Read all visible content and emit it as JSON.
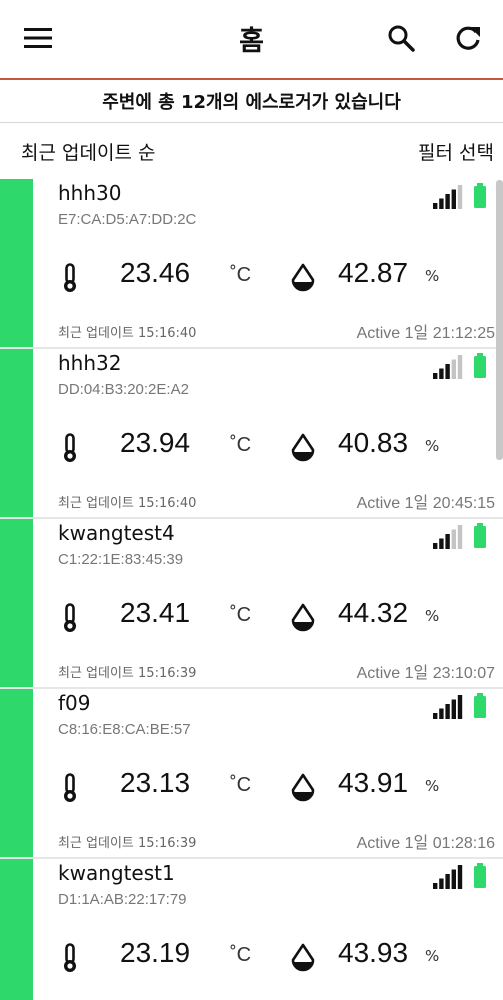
{
  "appbar": {
    "title": "홈",
    "menu_icon": "menu-icon",
    "search_icon": "search-icon",
    "refresh_icon": "refresh-icon",
    "divider_color": "#c8553d"
  },
  "banner": {
    "text": "주변에 총 12개의 에스로거가 있습니다"
  },
  "sortbar": {
    "sort_label": "최근 업데이트 순",
    "filter_label": "필터 선택"
  },
  "colors": {
    "active_strip": "#2ed86b",
    "battery": "#2ed86b"
  },
  "devices": [
    {
      "name": "hhh30",
      "mac": "E7:CA:D5:A7:DD:2C",
      "temperature": "23.46",
      "temp_unit": "˚C",
      "humidity": "42.87",
      "hum_unit": "%",
      "updated": "최근 업데이트 15:16:40",
      "active": "Active  1일 21:12:25",
      "signal_bars": 4
    },
    {
      "name": "hhh32",
      "mac": "DD:04:B3:20:2E:A2",
      "temperature": "23.94",
      "temp_unit": "˚C",
      "humidity": "40.83",
      "hum_unit": "%",
      "updated": "최근 업데이트 15:16:40",
      "active": "Active  1일 20:45:15",
      "signal_bars": 3
    },
    {
      "name": "kwangtest4",
      "mac": "C1:22:1E:83:45:39",
      "temperature": "23.41",
      "temp_unit": "˚C",
      "humidity": "44.32",
      "hum_unit": "%",
      "updated": "최근 업데이트 15:16:39",
      "active": "Active  1일 23:10:07",
      "signal_bars": 3
    },
    {
      "name": "f09",
      "mac": "C8:16:E8:CA:BE:57",
      "temperature": "23.13",
      "temp_unit": "˚C",
      "humidity": "43.91",
      "hum_unit": "%",
      "updated": "최근 업데이트 15:16:39",
      "active": "Active  1일 01:28:16",
      "signal_bars": 5
    },
    {
      "name": "kwangtest1",
      "mac": "D1:1A:AB:22:17:79",
      "temperature": "23.19",
      "temp_unit": "˚C",
      "humidity": "43.93",
      "hum_unit": "%",
      "updated": "",
      "active": "",
      "signal_bars": 5
    }
  ]
}
